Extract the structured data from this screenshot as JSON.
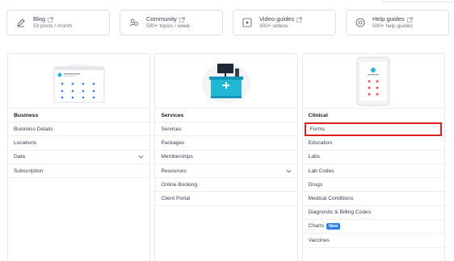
{
  "resources": [
    {
      "title": "Blog",
      "subtitle": "53 posts / month",
      "icon": "pen-icon"
    },
    {
      "title": "Community",
      "subtitle": "500+ topics / week",
      "icon": "community-icon"
    },
    {
      "title": "Video guides",
      "subtitle": "300+ videos",
      "icon": "video-icon"
    },
    {
      "title": "Help guides",
      "subtitle": "500+ help guides",
      "icon": "help-icon"
    }
  ],
  "columns": {
    "business": {
      "heading": "Business",
      "items": [
        "Business Details",
        "Locations",
        "Data",
        "Subscription"
      ]
    },
    "services": {
      "heading": "Services",
      "items": [
        "Services",
        "Packages",
        "Memberships",
        "Resources",
        "Online Booking",
        "Client Portal"
      ]
    },
    "clinical": {
      "heading": "Clinical",
      "items": [
        "Forms",
        "Education",
        "Labs",
        "Lab Codes",
        "Drugs",
        "Medical Conditions",
        "Diagnostic & Billing Codes",
        "Charts",
        "Vaccines"
      ],
      "charts_badge": "New"
    }
  },
  "colors": {
    "accent": "#2b7de9",
    "highlight": "#e02020",
    "teal": "#20b8d4"
  }
}
